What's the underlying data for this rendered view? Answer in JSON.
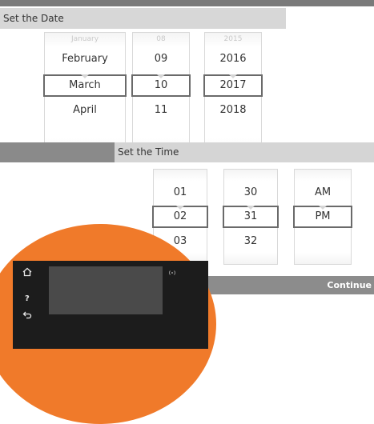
{
  "date": {
    "title": "Set the Date",
    "month": {
      "above": "January",
      "prev": "February",
      "selected": "March",
      "next": "April"
    },
    "day": {
      "above": "08",
      "prev": "09",
      "selected": "10",
      "next": "11"
    },
    "year": {
      "above": "2015",
      "prev": "2016",
      "selected": "2017",
      "next": "2018"
    }
  },
  "time": {
    "title": "Set the Time",
    "hour": {
      "prev": "01",
      "selected": "02",
      "next": "03"
    },
    "minute": {
      "prev": "30",
      "selected": "31",
      "next": "32"
    },
    "ampm": {
      "prev": "AM",
      "selected": "PM"
    },
    "continue_label": "Continue"
  },
  "device": {
    "icons": [
      "home-icon",
      "help-icon",
      "back-icon",
      "wireless-icon"
    ],
    "help_glyph": "?"
  },
  "colors": {
    "accent_orange": "#f07a2a",
    "header_gray": "#d7d7d7",
    "bar_gray": "#8c8c8c"
  }
}
